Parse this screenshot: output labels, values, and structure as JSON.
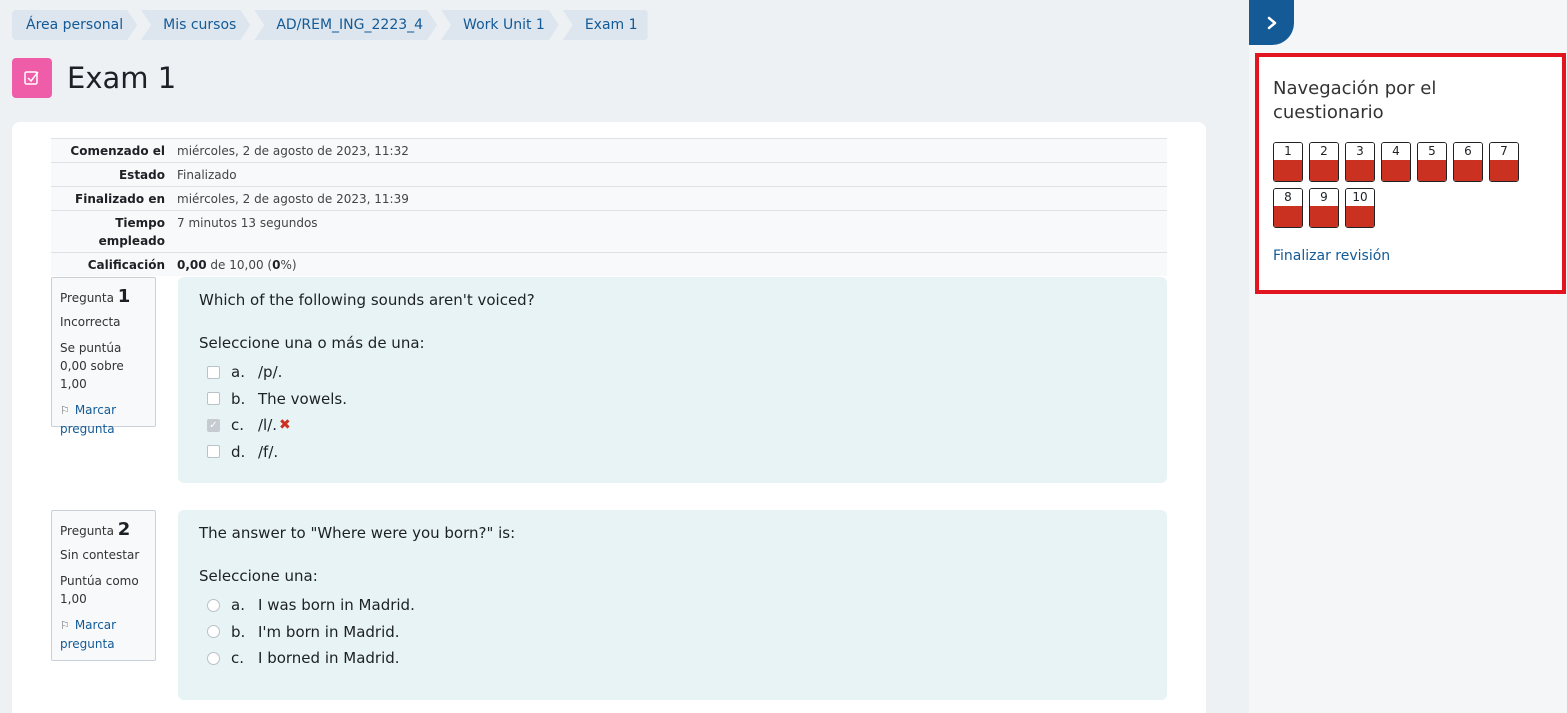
{
  "breadcrumb": [
    "Área personal",
    "Mis cursos",
    "AD/REM_ING_2223_4",
    "Work Unit 1",
    "Exam 1"
  ],
  "page_title": "Exam 1",
  "icons": {
    "quiz": "quiz-checkbox-icon",
    "flag": "flag-icon",
    "incorrect": "x-mark-icon",
    "drawer_toggle": "chevron-right-icon"
  },
  "colors": {
    "accent": "#135a96",
    "quiz_icon_bg": "#ef5da8",
    "incorrect": "#ca3120",
    "highlight_border": "#e2141f"
  },
  "summary": [
    {
      "label": "Comenzado el",
      "value": "miércoles, 2 de agosto de 2023, 11:32"
    },
    {
      "label": "Estado",
      "value": "Finalizado"
    },
    {
      "label": "Finalizado en",
      "value": "miércoles, 2 de agosto de 2023, 11:39"
    },
    {
      "label": "Tiempo empleado",
      "value": "7 minutos 13 segundos"
    },
    {
      "label": "Calificación",
      "grade": "0,00",
      "of": " de 10,00 (",
      "pct": "0",
      "close": "%)"
    }
  ],
  "questions": [
    {
      "label": "Pregunta",
      "number": "1",
      "state": "Incorrecta",
      "grade": "Se puntúa 0,00 sobre 1,00",
      "flag": "Marcar pregunta",
      "text": "Which of the following sounds aren't voiced?",
      "prompt": "Seleccione una o más de una:",
      "options": [
        {
          "letter": "a.",
          "text": "/p/."
        },
        {
          "letter": "b.",
          "text": "The vowels."
        },
        {
          "letter": "c.",
          "text": "/l/.",
          "mark": "✖"
        },
        {
          "letter": "d.",
          "text": "/f/."
        }
      ]
    },
    {
      "label": "Pregunta",
      "number": "2",
      "state": "Sin contestar",
      "grade": "Puntúa como 1,00",
      "flag": "Marcar pregunta",
      "text": "The answer to \"Where were you born?\" is:",
      "prompt": "Seleccione una:",
      "options": [
        {
          "letter": "a.",
          "text": "I was born in Madrid."
        },
        {
          "letter": "b.",
          "text": "I'm born in Madrid."
        },
        {
          "letter": "c.",
          "text": "I borned in Madrid."
        }
      ]
    }
  ],
  "quiz_nav": {
    "title": "Navegación por el cuestionario",
    "buttons": [
      "1",
      "2",
      "3",
      "4",
      "5",
      "6",
      "7",
      "8",
      "9",
      "10"
    ],
    "finish": "Finalizar revisión"
  }
}
